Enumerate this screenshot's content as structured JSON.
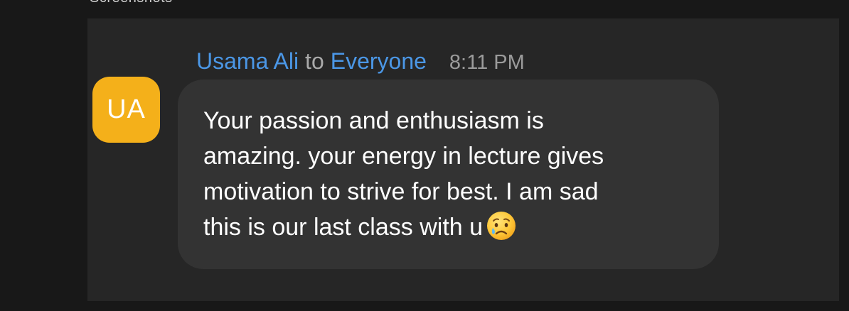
{
  "section": {
    "label": "Screenshots"
  },
  "chat_message": {
    "avatar_initials": "UA",
    "sender": "Usama Ali",
    "to_word": "to",
    "recipient": "Everyone",
    "timestamp": "8:11 PM",
    "message_lines": [
      "Your passion and enthusiasm is",
      "amazing. your energy in lecture gives",
      "motivation to strive for best. I am sad",
      "this is our last class with u"
    ],
    "emoji": "sad-but-relieved-face-emoji"
  },
  "colors": {
    "avatar_background": "#f4b01a",
    "name_link": "#4b97e6",
    "bubble_background": "#333333",
    "panel_background": "#262626",
    "page_background": "#181818"
  }
}
